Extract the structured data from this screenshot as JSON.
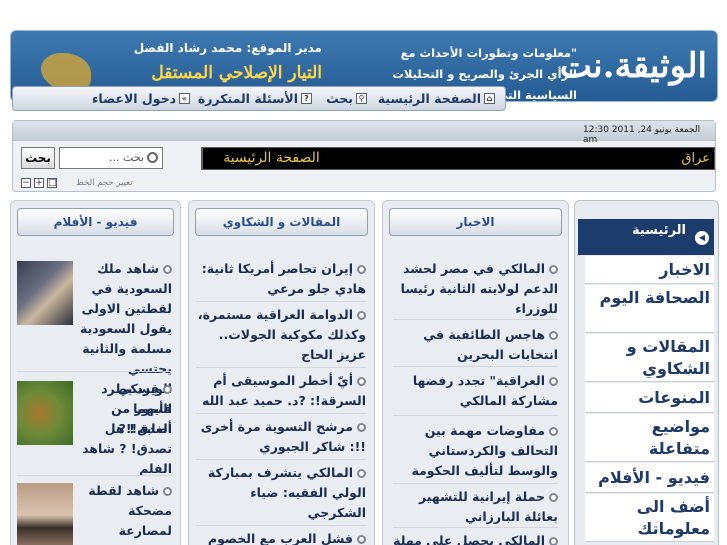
{
  "header": {
    "logo": "الوثيقة.نت",
    "slogan": "\"معلومات وتطورات الأحداث مع الرأي الجرئ والصريح و التحليلات السياسية التي لاتخضع للرقابة\"",
    "manager": "مدير الموقع: محمد رشاد الفضل",
    "party": "التيار الإصلاحي المستقل"
  },
  "nav": {
    "home": "الصفحة الرئيسية",
    "search": "بحث",
    "faq": "الأسئلة المتكررة",
    "login": "دخول الاعضاء"
  },
  "toolbar": {
    "datetime": "الجمعة يونيو 24, 2011 12:30 am",
    "ticker_home": "الصفحة الرئيسية",
    "ticker_text": "عراق",
    "search_button": "بحث",
    "search_placeholder": "بحث ...",
    "font_size_label": "تغيير حجم الخط"
  },
  "columns": {
    "news": {
      "title": "الاخبار",
      "items": [
        "المالكي في مصر لحشد الدعم لولايته الثانية رئيسا للوزراء",
        "هاجس الطائفية في انتخابات البحرين",
        "العراقية\" تجدد رفضها مشاركة المالكي",
        "مفاوضات مهمة بين التحالف والكردستاني والوسط لتأليف الحكومة",
        "حملة إيرانية للتشهير بعائلة البارزاني",
        "المالكي يحصل على مهلة"
      ]
    },
    "articles": {
      "title": "المقالات و الشكاوي",
      "items": [
        "إيران تحاصر أمريكا ثانية: هادي جلو مرعي",
        "الدوامة العراقية مستمرة، وكذلك مكوكية الجولات.. عزيز الحاج",
        "أيّ أخطر الموسيقى أم السرقة!: ?د. حميد عبد الله",
        "مرشح التسوية مرة أخرى !!: شاكر الجبوري",
        "المالكي يتشرف بمباركة الولي الفقيه: ضياء الشكرجي",
        "فشل العرب مع الخصوم و"
      ]
    },
    "video": {
      "title": "فيديو - الأفلام",
      "items": [
        "شاهد ملك السعودية في لقطتين الاولى يقول السعودية مسلمة والثانية يحتسي الويسكي فأيهما أصدق!!?",
        "قرد يطرد النمور من الغابة ! هل تصدق! ? شاهد الفلم",
        "شاهد لقطة مضحكة لمصارعة الثيران"
      ]
    }
  },
  "sidebar": {
    "active": "الرئيسية",
    "items": [
      "الاخبار",
      "الصحافة اليوم",
      "المقالات و الشكاوي",
      "المنوعات",
      "مواضيع متفاعلة",
      "فيديو - الأفلام",
      "أضف الى معلوماتك"
    ]
  },
  "colors": {
    "header_blue": "#2f6aa3",
    "nav_text": "#1f3a66",
    "ticker_gold": "#e8c84a",
    "sidebar_active": "#1c3d6b"
  }
}
